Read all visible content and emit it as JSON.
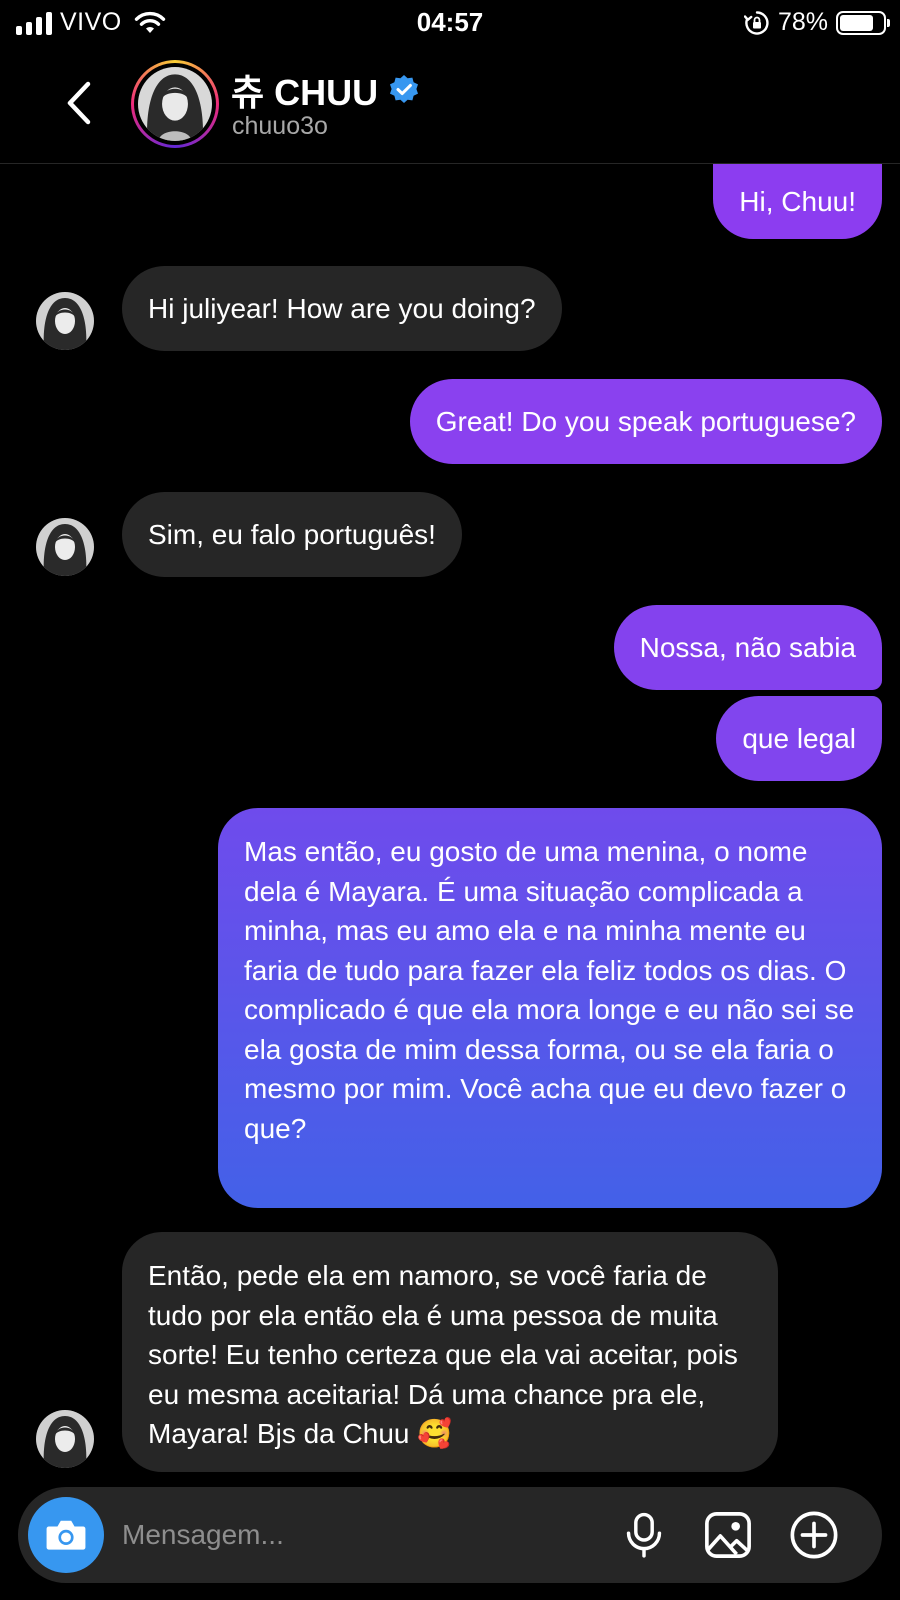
{
  "status_bar": {
    "carrier": "VIVO",
    "time": "04:57",
    "battery_percent": "78%",
    "battery_level": 0.78
  },
  "header": {
    "name": "츄 CHUU",
    "handle": "chuuo3o",
    "verified": true
  },
  "colors": {
    "background": "#000000",
    "incoming_bubble": "#262626",
    "outgoing_purple": "#8c3df0",
    "outgoing_blue": "#4361e8",
    "accent_blue": "#3797f0",
    "secondary_text": "#a8a8a8"
  },
  "messages": [
    {
      "from": "me",
      "text": "Hi, Chuu!"
    },
    {
      "from": "them",
      "text": "Hi juliyear! How are you doing?"
    },
    {
      "from": "me",
      "text": "Great! Do you speak portuguese?"
    },
    {
      "from": "them",
      "text": "Sim, eu falo português!"
    },
    {
      "from": "me",
      "text": "Nossa, não sabia"
    },
    {
      "from": "me",
      "text": "que legal"
    },
    {
      "from": "me",
      "text": "Mas então, eu gosto de uma menina, o nome dela é Mayara. É uma situação complicada a minha, mas eu amo ela e na minha mente eu faria de tudo para fazer ela feliz todos os dias. O complicado é que ela mora longe e eu não sei se ela gosta de mim dessa forma, ou se ela faria o mesmo por mim. Você acha que eu devo fazer o que?"
    },
    {
      "from": "them",
      "text": "Então, pede ela em namoro, se você faria de tudo por ela então ela é uma pessoa de muita sorte! Eu tenho certeza que ela vai aceitar, pois eu mesma aceitaria! Dá uma chance pra ele, Mayara! Bjs da Chuu 🥰"
    }
  ],
  "composer": {
    "placeholder": "Mensagem..."
  },
  "icons": {
    "back": "chevron-left-icon",
    "verified": "verified-badge-icon",
    "camera": "camera-icon",
    "mic": "microphone-icon",
    "gallery": "image-icon",
    "more": "plus-circle-icon"
  }
}
